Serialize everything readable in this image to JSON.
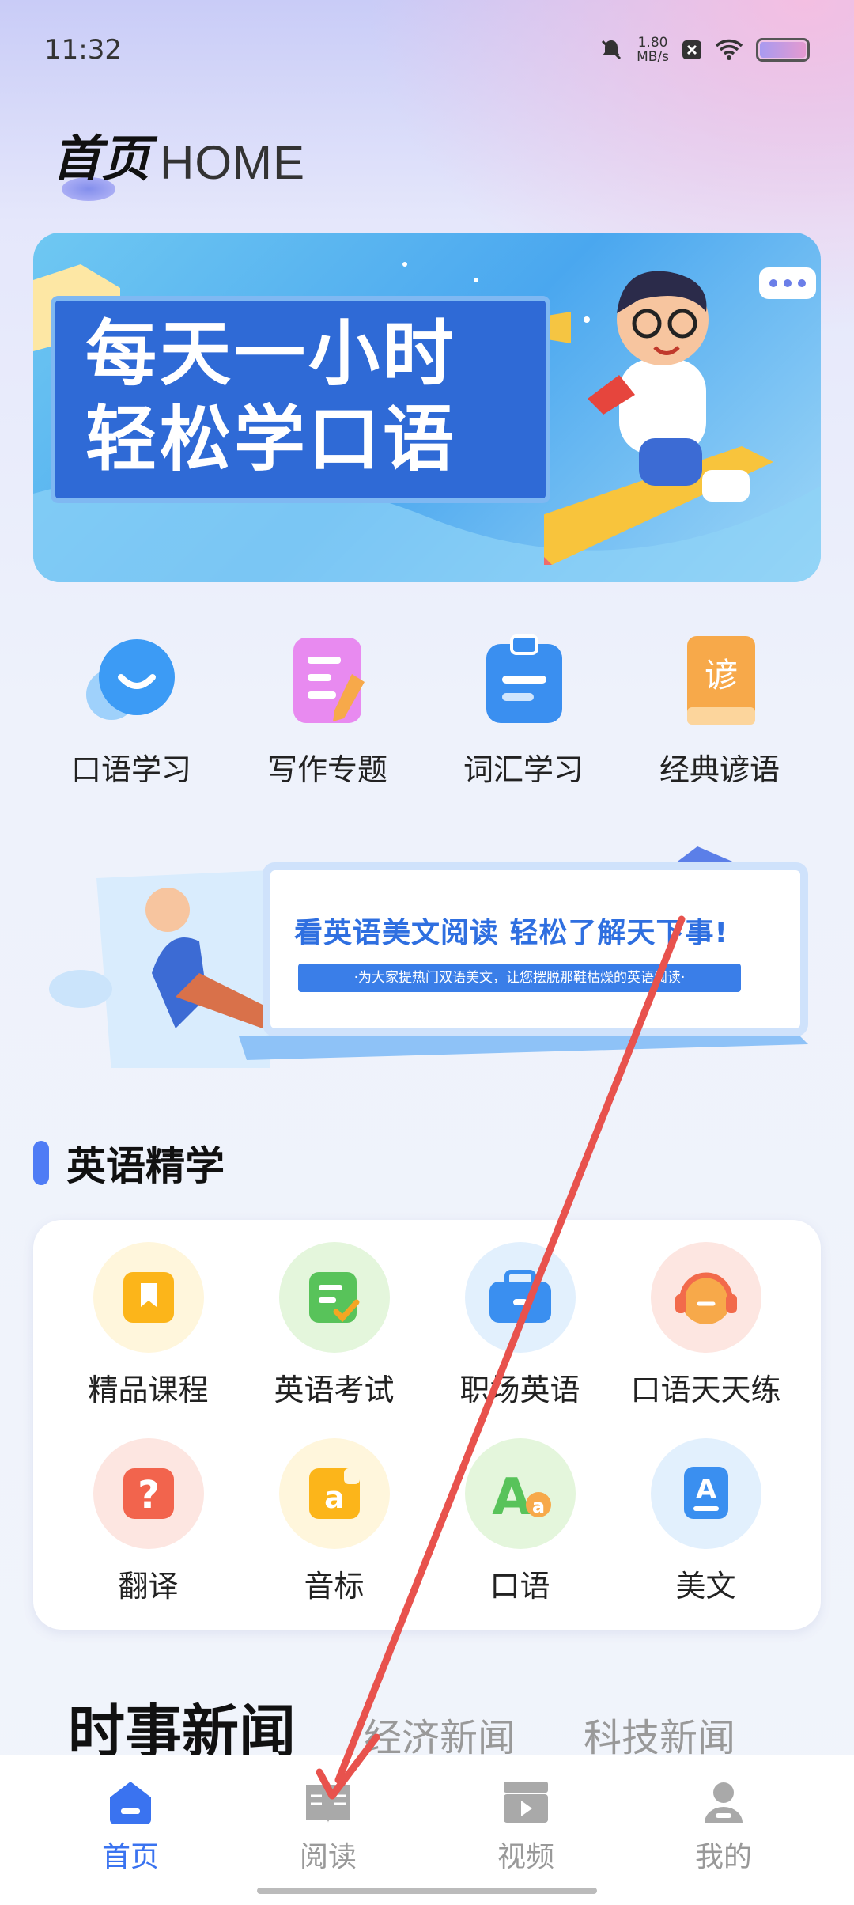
{
  "status": {
    "time": "11:32",
    "speed_value": "1.80",
    "speed_unit": "MB/s"
  },
  "header": {
    "title_cn": "首页",
    "title_en": "HOME"
  },
  "banner": {
    "line1": "每天一小时",
    "line2": "轻松学口语"
  },
  "quick_items": [
    {
      "label": "口语学习",
      "icon": "chat-bubble-icon"
    },
    {
      "label": "写作专题",
      "icon": "notepad-pen-icon"
    },
    {
      "label": "词汇学习",
      "icon": "clipboard-icon"
    },
    {
      "label": "经典谚语",
      "icon": "proverb-book-icon"
    }
  ],
  "reading_banner": {
    "headline": "看英语美文阅读  轻松了解天下事!",
    "subline": "·为大家提热门双语美文，让您摆脱那鞋枯燥的英语阅读·"
  },
  "section": {
    "title": "英语精学"
  },
  "study_items": [
    {
      "label": "精品课程",
      "icon": "bookmark-book-icon",
      "color": "#fcb51a"
    },
    {
      "label": "英语考试",
      "icon": "check-note-icon",
      "color": "#58c35a"
    },
    {
      "label": "职场英语",
      "icon": "briefcase-icon",
      "color": "#3a8ff0"
    },
    {
      "label": "口语天天练",
      "icon": "headset-icon",
      "color": "#f26a4b"
    },
    {
      "label": "翻译",
      "icon": "question-icon",
      "color": "#f2644d"
    },
    {
      "label": "音标",
      "icon": "letter-a-icon",
      "color": "#fcb51a"
    },
    {
      "label": "口语",
      "icon": "letters-aa-icon",
      "color": "#58c35a"
    },
    {
      "label": "美文",
      "icon": "letter-a-card-icon",
      "color": "#3a8ff0"
    }
  ],
  "news_tabs": [
    "时事新闻",
    "经济新闻",
    "科技新闻"
  ],
  "nav": [
    {
      "label": "首页",
      "icon": "home-icon",
      "active": true
    },
    {
      "label": "阅读",
      "icon": "book-icon",
      "active": false
    },
    {
      "label": "视频",
      "icon": "video-icon",
      "active": false
    },
    {
      "label": "我的",
      "icon": "profile-icon",
      "active": false
    }
  ],
  "colors": {
    "accent": "#3a73f0",
    "section_bar": "#4f7cf5",
    "arrow": "#e8524d"
  }
}
